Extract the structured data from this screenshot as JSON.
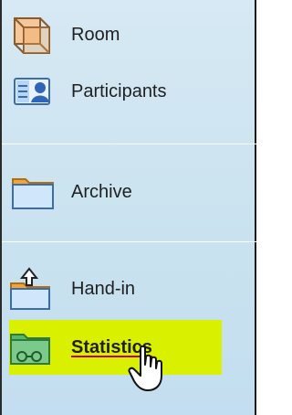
{
  "nav": {
    "items": [
      {
        "label": "Room",
        "icon": "room-cube-icon"
      },
      {
        "label": "Participants",
        "icon": "participants-card-icon"
      },
      {
        "label": "Archive",
        "icon": "archive-folder-icon"
      },
      {
        "label": "Hand-in",
        "icon": "hand-in-folder-icon"
      },
      {
        "label": "Statistics",
        "icon": "statistics-folder-icon",
        "selected": true
      }
    ]
  },
  "colors": {
    "panel_bg": "#cfe5f2",
    "highlight": "#d9f000",
    "underline": "#c00000"
  }
}
